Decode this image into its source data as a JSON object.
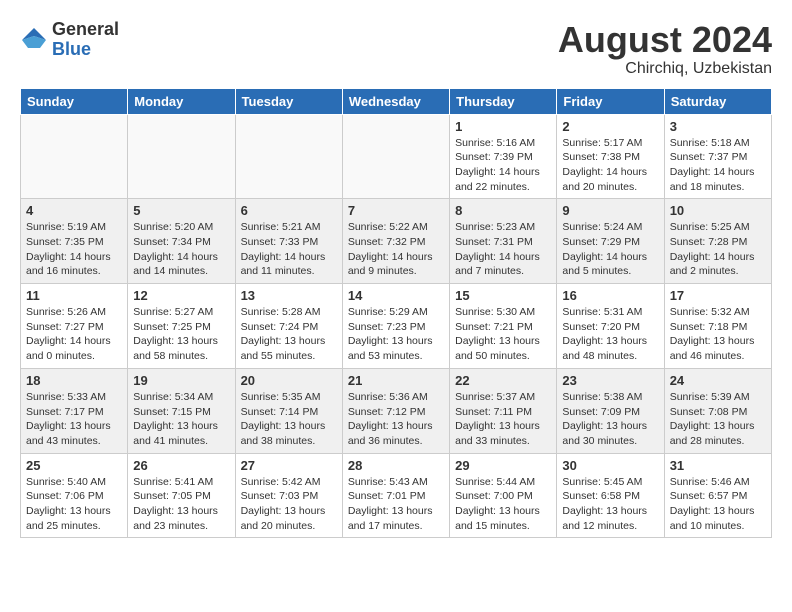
{
  "header": {
    "logo_general": "General",
    "logo_blue": "Blue",
    "month_title": "August 2024",
    "location": "Chirchiq, Uzbekistan"
  },
  "days_of_week": [
    "Sunday",
    "Monday",
    "Tuesday",
    "Wednesday",
    "Thursday",
    "Friday",
    "Saturday"
  ],
  "weeks": [
    [
      {
        "day": "",
        "info": ""
      },
      {
        "day": "",
        "info": ""
      },
      {
        "day": "",
        "info": ""
      },
      {
        "day": "",
        "info": ""
      },
      {
        "day": "1",
        "info": "Sunrise: 5:16 AM\nSunset: 7:39 PM\nDaylight: 14 hours\nand 22 minutes."
      },
      {
        "day": "2",
        "info": "Sunrise: 5:17 AM\nSunset: 7:38 PM\nDaylight: 14 hours\nand 20 minutes."
      },
      {
        "day": "3",
        "info": "Sunrise: 5:18 AM\nSunset: 7:37 PM\nDaylight: 14 hours\nand 18 minutes."
      }
    ],
    [
      {
        "day": "4",
        "info": "Sunrise: 5:19 AM\nSunset: 7:35 PM\nDaylight: 14 hours\nand 16 minutes."
      },
      {
        "day": "5",
        "info": "Sunrise: 5:20 AM\nSunset: 7:34 PM\nDaylight: 14 hours\nand 14 minutes."
      },
      {
        "day": "6",
        "info": "Sunrise: 5:21 AM\nSunset: 7:33 PM\nDaylight: 14 hours\nand 11 minutes."
      },
      {
        "day": "7",
        "info": "Sunrise: 5:22 AM\nSunset: 7:32 PM\nDaylight: 14 hours\nand 9 minutes."
      },
      {
        "day": "8",
        "info": "Sunrise: 5:23 AM\nSunset: 7:31 PM\nDaylight: 14 hours\nand 7 minutes."
      },
      {
        "day": "9",
        "info": "Sunrise: 5:24 AM\nSunset: 7:29 PM\nDaylight: 14 hours\nand 5 minutes."
      },
      {
        "day": "10",
        "info": "Sunrise: 5:25 AM\nSunset: 7:28 PM\nDaylight: 14 hours\nand 2 minutes."
      }
    ],
    [
      {
        "day": "11",
        "info": "Sunrise: 5:26 AM\nSunset: 7:27 PM\nDaylight: 14 hours\nand 0 minutes."
      },
      {
        "day": "12",
        "info": "Sunrise: 5:27 AM\nSunset: 7:25 PM\nDaylight: 13 hours\nand 58 minutes."
      },
      {
        "day": "13",
        "info": "Sunrise: 5:28 AM\nSunset: 7:24 PM\nDaylight: 13 hours\nand 55 minutes."
      },
      {
        "day": "14",
        "info": "Sunrise: 5:29 AM\nSunset: 7:23 PM\nDaylight: 13 hours\nand 53 minutes."
      },
      {
        "day": "15",
        "info": "Sunrise: 5:30 AM\nSunset: 7:21 PM\nDaylight: 13 hours\nand 50 minutes."
      },
      {
        "day": "16",
        "info": "Sunrise: 5:31 AM\nSunset: 7:20 PM\nDaylight: 13 hours\nand 48 minutes."
      },
      {
        "day": "17",
        "info": "Sunrise: 5:32 AM\nSunset: 7:18 PM\nDaylight: 13 hours\nand 46 minutes."
      }
    ],
    [
      {
        "day": "18",
        "info": "Sunrise: 5:33 AM\nSunset: 7:17 PM\nDaylight: 13 hours\nand 43 minutes."
      },
      {
        "day": "19",
        "info": "Sunrise: 5:34 AM\nSunset: 7:15 PM\nDaylight: 13 hours\nand 41 minutes."
      },
      {
        "day": "20",
        "info": "Sunrise: 5:35 AM\nSunset: 7:14 PM\nDaylight: 13 hours\nand 38 minutes."
      },
      {
        "day": "21",
        "info": "Sunrise: 5:36 AM\nSunset: 7:12 PM\nDaylight: 13 hours\nand 36 minutes."
      },
      {
        "day": "22",
        "info": "Sunrise: 5:37 AM\nSunset: 7:11 PM\nDaylight: 13 hours\nand 33 minutes."
      },
      {
        "day": "23",
        "info": "Sunrise: 5:38 AM\nSunset: 7:09 PM\nDaylight: 13 hours\nand 30 minutes."
      },
      {
        "day": "24",
        "info": "Sunrise: 5:39 AM\nSunset: 7:08 PM\nDaylight: 13 hours\nand 28 minutes."
      }
    ],
    [
      {
        "day": "25",
        "info": "Sunrise: 5:40 AM\nSunset: 7:06 PM\nDaylight: 13 hours\nand 25 minutes."
      },
      {
        "day": "26",
        "info": "Sunrise: 5:41 AM\nSunset: 7:05 PM\nDaylight: 13 hours\nand 23 minutes."
      },
      {
        "day": "27",
        "info": "Sunrise: 5:42 AM\nSunset: 7:03 PM\nDaylight: 13 hours\nand 20 minutes."
      },
      {
        "day": "28",
        "info": "Sunrise: 5:43 AM\nSunset: 7:01 PM\nDaylight: 13 hours\nand 17 minutes."
      },
      {
        "day": "29",
        "info": "Sunrise: 5:44 AM\nSunset: 7:00 PM\nDaylight: 13 hours\nand 15 minutes."
      },
      {
        "day": "30",
        "info": "Sunrise: 5:45 AM\nSunset: 6:58 PM\nDaylight: 13 hours\nand 12 minutes."
      },
      {
        "day": "31",
        "info": "Sunrise: 5:46 AM\nSunset: 6:57 PM\nDaylight: 13 hours\nand 10 minutes."
      }
    ]
  ]
}
